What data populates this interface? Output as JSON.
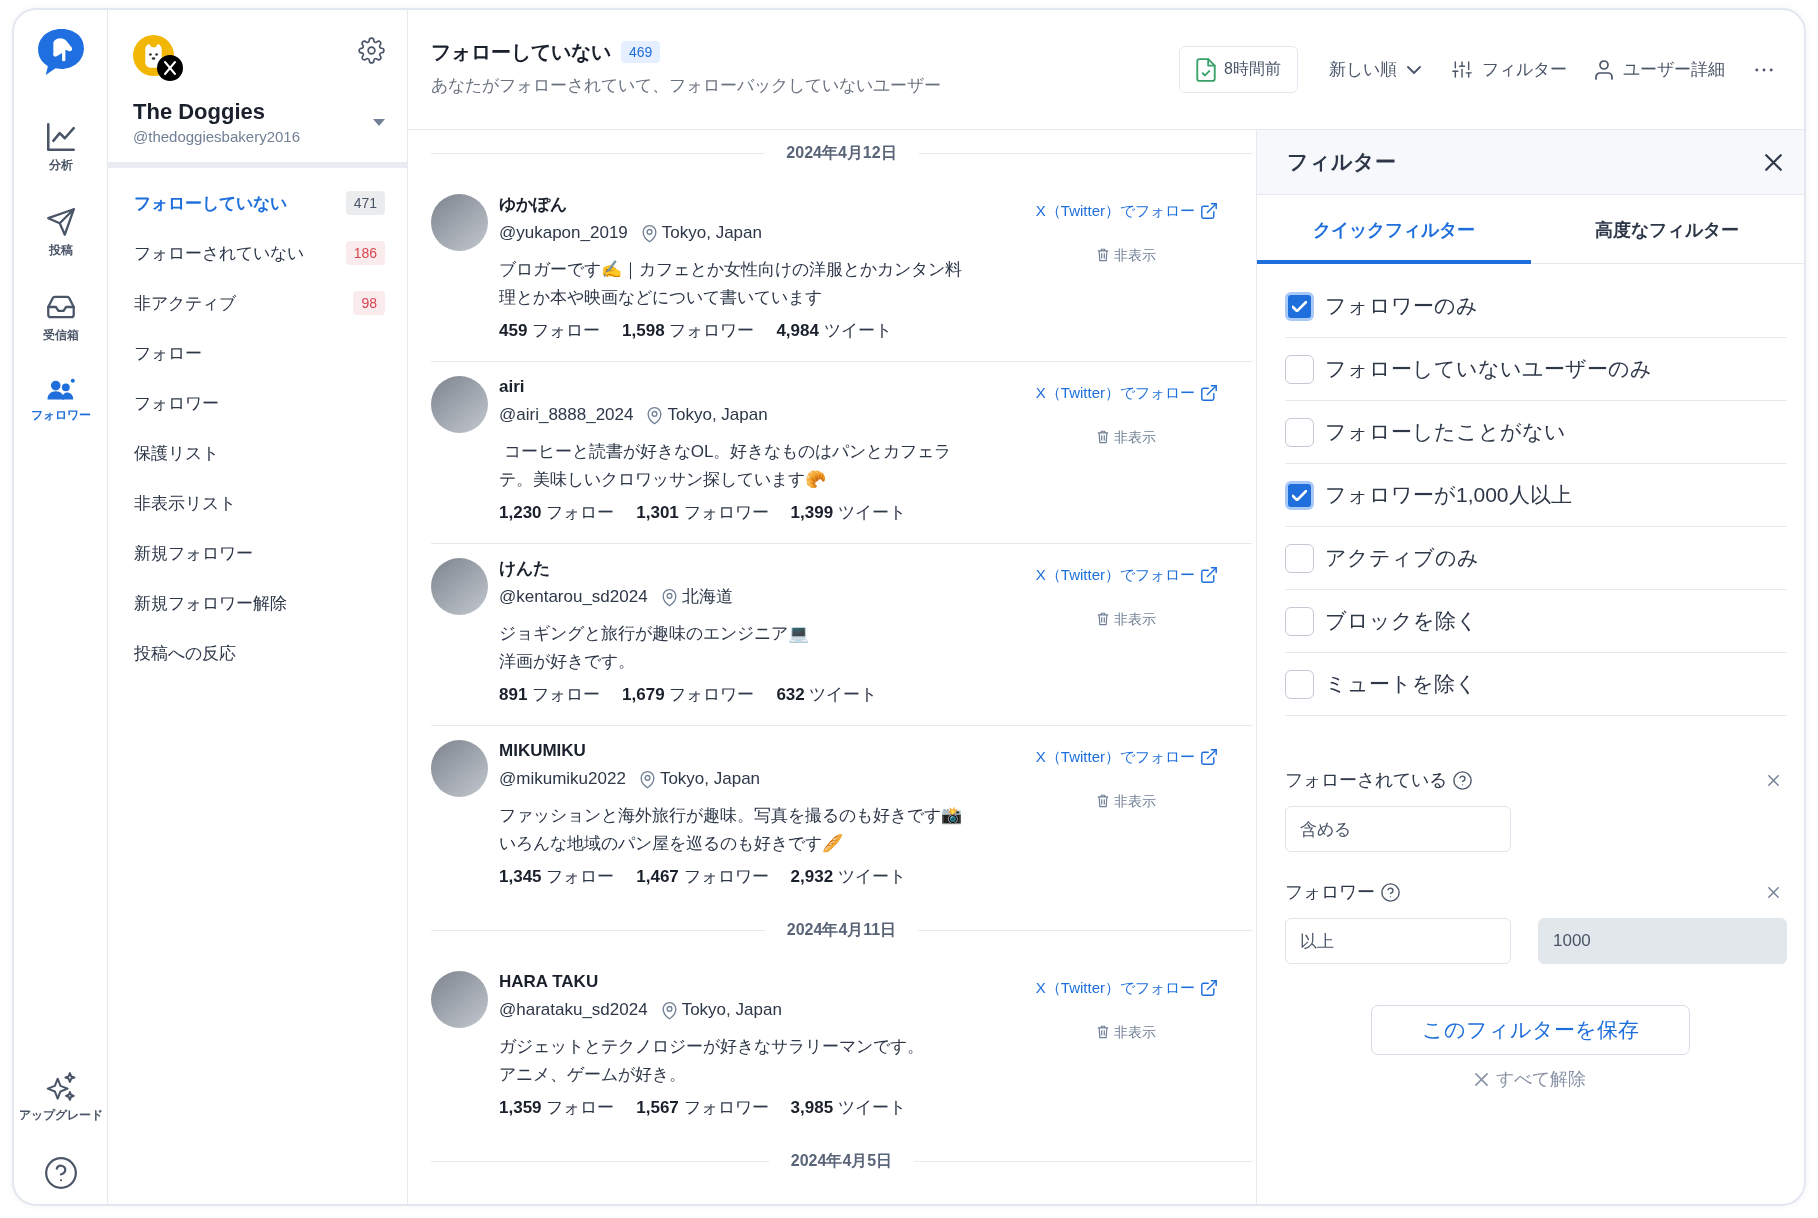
{
  "rail": {
    "items": [
      {
        "kind": "analytics",
        "label": "分析",
        "selected": false
      },
      {
        "kind": "post",
        "label": "投稿",
        "selected": false
      },
      {
        "kind": "inbox",
        "label": "受信箱",
        "selected": false
      },
      {
        "kind": "followers",
        "label": "フォロワー",
        "selected": true
      }
    ],
    "upgrade": "アップグレード"
  },
  "account": {
    "name": "The Doggies",
    "handle": "@thedoggiesbakery2016"
  },
  "sidebar": {
    "items": [
      {
        "label": "フォローしていない",
        "selected": true,
        "badge": {
          "count": "471",
          "color": "#4a5568"
        }
      },
      {
        "label": "フォローされていない",
        "selected": false,
        "badge": {
          "count": "186",
          "color": "#d64550"
        }
      },
      {
        "label": "非アクティブ",
        "selected": false,
        "badge": {
          "count": "98",
          "color": "#d64550"
        }
      },
      {
        "label": "フォロー",
        "selected": false
      },
      {
        "label": "フォロワー",
        "selected": false
      },
      {
        "label": "保護リスト",
        "selected": false
      },
      {
        "label": "非表示リスト",
        "selected": false
      },
      {
        "label": "新規フォロワー",
        "selected": false
      },
      {
        "label": "新規フォロワー解除",
        "selected": false
      },
      {
        "label": "投稿への反応",
        "selected": false
      }
    ]
  },
  "header": {
    "title": "フォローしていない",
    "count": "469",
    "subtitle": "あなたがフォローされていて、フォローバックしていないユーザー",
    "sync_label": "8時間前",
    "sort_label": "新しい順",
    "filter_label": "フィルター",
    "details_label": "ユーザー詳細"
  },
  "feed": {
    "sections": [
      {
        "date": "2024年4月12日",
        "users": [
          {
            "name": "ゆかぽん",
            "handle": "@yukapon_2019",
            "location": "Tokyo, Japan",
            "bio": [
              "ブロガーです✍️｜カフェとか女性向けの洋服とかカンタン料理とか本や映画などについて書いています"
            ],
            "stats": [
              "**459** フォロー",
              "**1,598** フォロワー",
              "**4,984** ツイート"
            ],
            "follow_link": "X（Twitter）でフォロー",
            "hide": "非表示"
          },
          {
            "name": "airi",
            "handle": "@airi_8888_2024",
            "location": "Tokyo, Japan",
            "bio": [
              " コーヒーと読書が好きなOL。好きなものはパンとカフェラテ。美味しいクロワッサン探しています🥐"
            ],
            "stats": [
              "**1,230** フォロー",
              "**1,301** フォロワー",
              "**1,399** ツイート"
            ],
            "follow_link": "X（Twitter）でフォロー",
            "hide": "非表示"
          },
          {
            "name": "けんた",
            "handle": "@kentarou_sd2024",
            "location": "北海道",
            "bio": [
              "ジョギングと旅行が趣味のエンジニア💻",
              "洋画が好きです。"
            ],
            "stats": [
              "**891** フォロー",
              "**1,679** フォロワー",
              "**632** ツイート"
            ],
            "follow_link": "X（Twitter）でフォロー",
            "hide": "非表示"
          },
          {
            "name": "MIKUMIKU",
            "handle": "@mikumiku2022",
            "location": "Tokyo, Japan",
            "bio": [
              "ファッションと海外旅行が趣味。写真を撮るのも好きです📸いろんな地域のパン屋を巡るのも好きです🥖"
            ],
            "stats": [
              "**1,345** フォロー",
              "**1,467** フォロワー",
              "**2,932** ツイート"
            ],
            "follow_link": "X（Twitter）でフォロー",
            "hide": "非表示"
          }
        ]
      },
      {
        "date": "2024年4月11日",
        "users": [
          {
            "name": "HARA TAKU",
            "handle": "@harataku_sd2024",
            "location": "Tokyo, Japan",
            "bio": [
              "ガジェットとテクノロジーが好きなサラリーマンです。",
              "アニメ、ゲームが好き。"
            ],
            "stats": [
              "**1,359** フォロー",
              "**1,567** フォロワー",
              "**3,985** ツイート"
            ],
            "follow_link": "X（Twitter）でフォロー",
            "hide": "非表示"
          }
        ]
      },
      {
        "date": "2024年4月5日"
      }
    ]
  },
  "filter_panel": {
    "title": "フィルター",
    "tabs": [
      {
        "label": "クイックフィルター",
        "selected": true
      },
      {
        "label": "高度なフィルター",
        "selected": false
      }
    ],
    "options": [
      {
        "label": "フォロワーのみ",
        "checked": true
      },
      {
        "label": "フォローしていないユーザーのみ",
        "checked": false
      },
      {
        "label": "フォローしたことがない",
        "checked": false
      },
      {
        "label": "フォロワーが1,000人以上",
        "checked": true
      },
      {
        "label": "アクティブのみ",
        "checked": false
      },
      {
        "label": "ブロックを除く",
        "checked": false
      },
      {
        "label": "ミュートを除く",
        "checked": false
      }
    ],
    "conditions": [
      {
        "label": "フォローされている",
        "fields": [
          {
            "kind": "select",
            "value": "含める"
          }
        ]
      },
      {
        "label": "フォロワー",
        "fields": [
          {
            "kind": "select",
            "value": "以上"
          },
          {
            "kind": "number",
            "value": "1000"
          }
        ]
      }
    ],
    "save_button": "このフィルターを保存",
    "clear_all": "すべて解除"
  }
}
